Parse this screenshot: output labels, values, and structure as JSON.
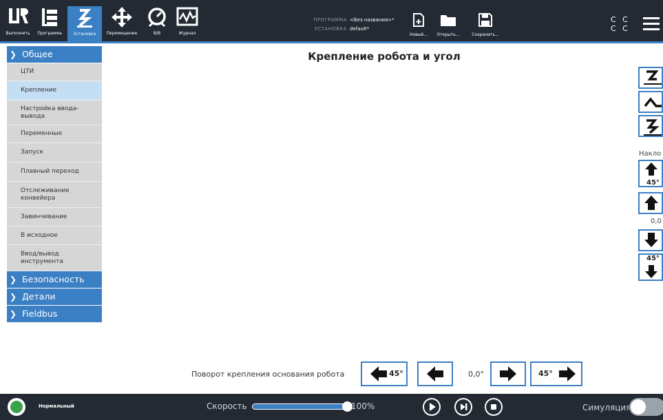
{
  "topbar": {
    "nav": [
      {
        "name": "nav-run",
        "label": "Выполнить",
        "icon": "ur-logo-icon"
      },
      {
        "name": "nav-program",
        "label": "Программа",
        "icon": "program-tree-icon"
      },
      {
        "name": "nav-install",
        "label": "Установка",
        "icon": "robot-arm-icon",
        "active": true
      },
      {
        "name": "nav-move",
        "label": "Перемещение",
        "icon": "move-arrows-icon"
      },
      {
        "name": "nav-io",
        "label": "В/В",
        "icon": "io-gauge-icon"
      },
      {
        "name": "nav-log",
        "label": "Журнал",
        "icon": "log-chart-icon"
      }
    ],
    "program_key": "ПРОГРАММА",
    "program_value": "<Без названия>*",
    "install_key": "УСТАНОВКА",
    "install_value": "default*",
    "new_label": "Новый...",
    "open_label": "Открыть...",
    "save_label": "Сохранить...",
    "cc_line1": "C C",
    "cc_line2": "C C"
  },
  "sidebar": {
    "general": "Общее",
    "items": [
      "ЦТИ",
      "Крепление",
      "Настройка ввода-вывода",
      "Переменные",
      "Запуск",
      "Плавный переход",
      "Отслеживание конвейера",
      "Завинчивание",
      "В исходное",
      "Ввод/вывод инструмента"
    ],
    "selected_index": 1,
    "safety": "Безопасность",
    "details": "Детали",
    "fieldbus": "Fieldbus"
  },
  "main": {
    "title": "Крепление робота и угол",
    "tilt_label": "Накло",
    "tilt_up_45": "45°",
    "tilt_value": "0,0",
    "tilt_down_45": "45°",
    "rotation_label": "Поворот крепления основания робота",
    "rot_left_45": "45°",
    "rotation_value": "0,0°",
    "rot_right_45": "45°"
  },
  "footer": {
    "status": "Нормальный",
    "speed_label": "Скорость",
    "speed_value": "100%",
    "speed_fraction": 1.0,
    "simulation_label": "Симуляция",
    "colors": {
      "accent": "#3b7fc4",
      "status_ok": "#3aa34a",
      "bar": "#242a33"
    }
  }
}
